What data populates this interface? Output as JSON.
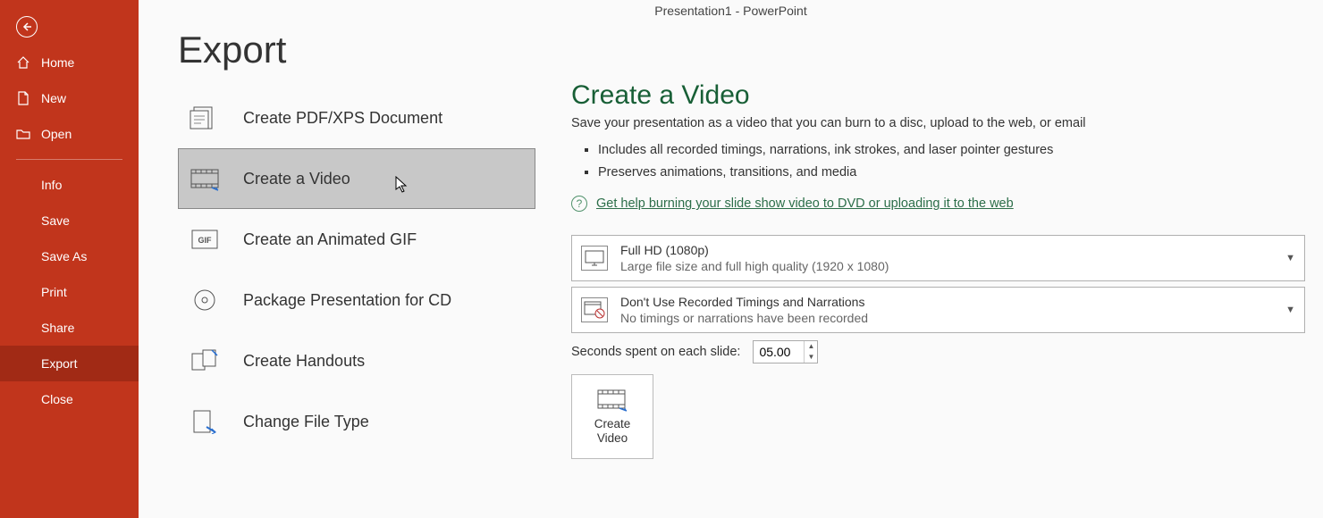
{
  "titlebar": "Presentation1  -  PowerPoint",
  "sidebar": {
    "items": [
      {
        "label": "Home"
      },
      {
        "label": "New"
      },
      {
        "label": "Open"
      },
      {
        "label": "Info"
      },
      {
        "label": "Save"
      },
      {
        "label": "Save As"
      },
      {
        "label": "Print"
      },
      {
        "label": "Share"
      },
      {
        "label": "Export"
      },
      {
        "label": "Close"
      }
    ]
  },
  "page": {
    "title": "Export"
  },
  "export_options": [
    {
      "label": "Create PDF/XPS Document"
    },
    {
      "label": "Create a Video"
    },
    {
      "label": "Create an Animated GIF"
    },
    {
      "label": "Package Presentation for CD"
    },
    {
      "label": "Create Handouts"
    },
    {
      "label": "Change File Type"
    }
  ],
  "video": {
    "title": "Create a Video",
    "desc": "Save your presentation as a video that you can burn to a disc, upload to the web, or email",
    "bullet1": "Includes all recorded timings, narrations, ink strokes, and laser pointer gestures",
    "bullet2": "Preserves animations, transitions, and media",
    "help_link": "Get help burning your slide show video to DVD or uploading it to the web",
    "quality": {
      "title": "Full HD (1080p)",
      "sub": "Large file size and full high quality (1920 x 1080)"
    },
    "timings": {
      "title": "Don't Use Recorded Timings and Narrations",
      "sub": "No timings or narrations have been recorded"
    },
    "seconds_label": "Seconds spent on each slide:",
    "seconds_value": "05.00",
    "create_button": "Create\nVideo"
  }
}
